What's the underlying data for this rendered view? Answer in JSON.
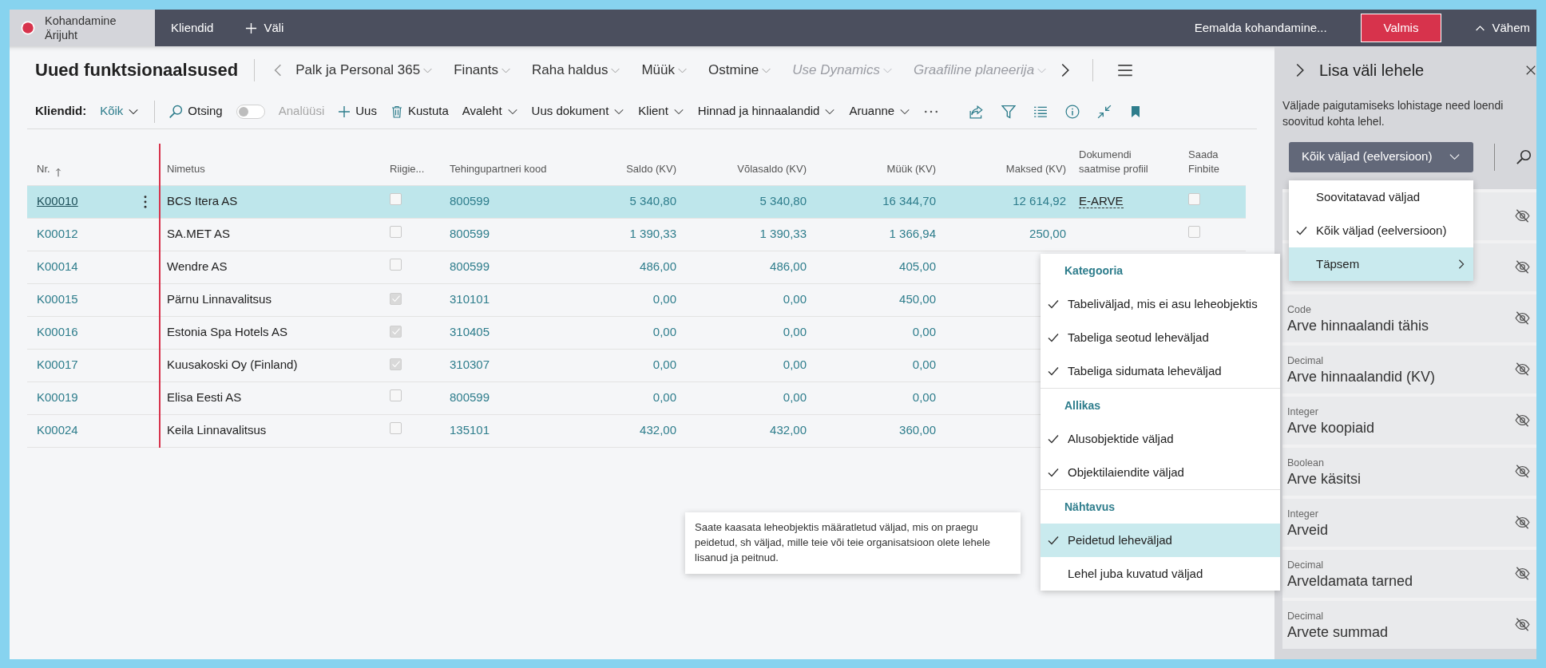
{
  "topbar": {
    "customization": {
      "title": "Kohandamine",
      "subtitle": "Ärijuht"
    },
    "items": [
      {
        "label": "Kliendid",
        "kind": "text"
      },
      {
        "label": "Väli",
        "kind": "add"
      }
    ],
    "remove_link": "Eemalda kohandamine...",
    "done_button": "Valmis",
    "collapse": "Vähem"
  },
  "page": {
    "title": "Uued funktsionaalsused",
    "nav": [
      {
        "label": "Palk ja Personal 365",
        "disabled": false
      },
      {
        "label": "Finants",
        "disabled": false
      },
      {
        "label": "Raha haldus",
        "disabled": false
      },
      {
        "label": "Müük",
        "disabled": false
      },
      {
        "label": "Ostmine",
        "disabled": false
      },
      {
        "label": "Use Dynamics",
        "disabled": true
      },
      {
        "label": "Graafiline planeerija",
        "disabled": true
      }
    ]
  },
  "actions": {
    "filter_label": "Kliendid:",
    "filter_value": "Kõik",
    "items": [
      {
        "kind": "search",
        "label": "Otsing"
      },
      {
        "kind": "toggle",
        "label": "Analüüsi",
        "on": false,
        "disabled": true
      },
      {
        "kind": "add",
        "label": "Uus"
      },
      {
        "kind": "delete",
        "label": "Kustuta"
      },
      {
        "kind": "menu",
        "label": "Avaleht"
      },
      {
        "kind": "menu",
        "label": "Uus dokument"
      },
      {
        "kind": "menu",
        "label": "Klient"
      },
      {
        "kind": "menu",
        "label": "Hinnad ja hinnaalandid"
      },
      {
        "kind": "menu",
        "label": "Aruanne"
      }
    ]
  },
  "table": {
    "columns": [
      {
        "label": "Nr.",
        "sorted": true
      },
      {
        "label": "Nimetus",
        "sorted": false
      },
      {
        "label": "Riigie...",
        "sorted": false
      },
      {
        "label": "Tehingupartneri kood",
        "sorted": false
      },
      {
        "label": "Saldo (KV)",
        "sorted": false
      },
      {
        "label": "Võlasaldo (KV)",
        "sorted": false
      },
      {
        "label": "Müük (KV)",
        "sorted": false
      },
      {
        "label": "Maksed (KV)",
        "sorted": false
      },
      {
        "label": "Dokumendi saatmise profiil",
        "sorted": false
      },
      {
        "label": "Saada Finbite",
        "sorted": false
      }
    ],
    "rows": [
      {
        "no": "K00010",
        "name": "BCS Itera AS",
        "government": false,
        "partner_code": "800599",
        "balance": "5 340,80",
        "balance_due": "5 340,80",
        "sales": "16 344,70",
        "payments": "12 614,92",
        "profile": "E-ARVE",
        "finbite": false,
        "selected": true
      },
      {
        "no": "K00012",
        "name": "SA.MET AS",
        "government": false,
        "partner_code": "800599",
        "balance": "1 390,33",
        "balance_due": "1 390,33",
        "sales": "1 366,94",
        "payments": "250,00",
        "finbite": false,
        "selected": false
      },
      {
        "no": "K00014",
        "name": "Wendre AS",
        "government": false,
        "partner_code": "800599",
        "balance": "486,00",
        "balance_due": "486,00",
        "sales": "405,00",
        "selected": false
      },
      {
        "no": "K00015",
        "name": "Pärnu Linnavalitsus",
        "government": true,
        "partner_code": "310101",
        "balance": "0,00",
        "balance_due": "0,00",
        "sales": "450,00",
        "selected": false
      },
      {
        "no": "K00016",
        "name": "Estonia Spa Hotels AS",
        "government": true,
        "partner_code": "310405",
        "balance": "0,00",
        "balance_due": "0,00",
        "sales": "0,00",
        "selected": false
      },
      {
        "no": "K00017",
        "name": "Kuusakoski Oy (Finland)",
        "government": true,
        "partner_code": "310307",
        "balance": "0,00",
        "balance_due": "0,00",
        "sales": "0,00",
        "selected": false
      },
      {
        "no": "K00019",
        "name": "Elisa Eesti AS",
        "government": false,
        "partner_code": "800599",
        "balance": "0,00",
        "balance_due": "0,00",
        "sales": "0,00",
        "selected": false
      },
      {
        "no": "K00024",
        "name": "Keila Linnavalitsus",
        "government": false,
        "partner_code": "135101",
        "balance": "432,00",
        "balance_due": "432,00",
        "sales": "360,00",
        "selected": false
      }
    ]
  },
  "submenu": {
    "sections": [
      {
        "heading": "Kategooria",
        "items": [
          {
            "label": "Tabeliväljad, mis ei asu leheobjektis",
            "checked": true,
            "selected": false
          },
          {
            "label": "Tabeliga seotud leheväljad",
            "checked": true,
            "selected": false
          },
          {
            "label": "Tabeliga sidumata leheväljad",
            "checked": true,
            "selected": false
          }
        ]
      },
      {
        "heading": "Allikas",
        "items": [
          {
            "label": "Alusobjektide väljad",
            "checked": true,
            "selected": false
          },
          {
            "label": "Objektilaiendite väljad",
            "checked": true,
            "selected": false
          }
        ]
      },
      {
        "heading": "Nähtavus",
        "items": [
          {
            "label": "Peidetud leheväljad",
            "checked": true,
            "selected": true
          },
          {
            "label": "Lehel juba kuvatud väljad",
            "checked": false,
            "selected": false
          }
        ]
      }
    ]
  },
  "tooltip": "Saate kaasata leheobjektis määratletud väljad, mis on praegu peidetud, sh väljad, mille teie või teie organisatsioon olete lehele lisanud ja peitnud.",
  "side_panel": {
    "title": "Lisa väli lehele",
    "description": "Väljade paigutamiseks lohistage need loendi soovitud kohta lehel.",
    "filter": "Kõik väljad (eelversioon)",
    "filter_menu": [
      {
        "label": "Soovitatavad väljad",
        "kind": "option",
        "checked": false,
        "selected": false
      },
      {
        "label": "Kõik väljad (eelversioon)",
        "kind": "option",
        "checked": true,
        "selected": false
      },
      {
        "label": "Täpsem",
        "kind": "submenu",
        "checked": false,
        "selected": true
      }
    ],
    "fields": [
      {
        "hidden": true
      },
      {
        "hidden": true
      },
      {
        "type": "Code",
        "name": "Arve hinnaalandi tähis",
        "hidden": true
      },
      {
        "type": "Decimal",
        "name": "Arve hinnaalandid (KV)",
        "hidden": true
      },
      {
        "type": "Integer",
        "name": "Arve koopiaid",
        "hidden": true
      },
      {
        "type": "Boolean",
        "name": "Arve käsitsi",
        "hidden": true
      },
      {
        "type": "Integer",
        "name": "Arveid",
        "hidden": true
      },
      {
        "type": "Decimal",
        "name": "Arveldamata tarned",
        "hidden": true
      },
      {
        "type": "Decimal",
        "name": "Arvete summad",
        "hidden": true
      }
    ]
  }
}
